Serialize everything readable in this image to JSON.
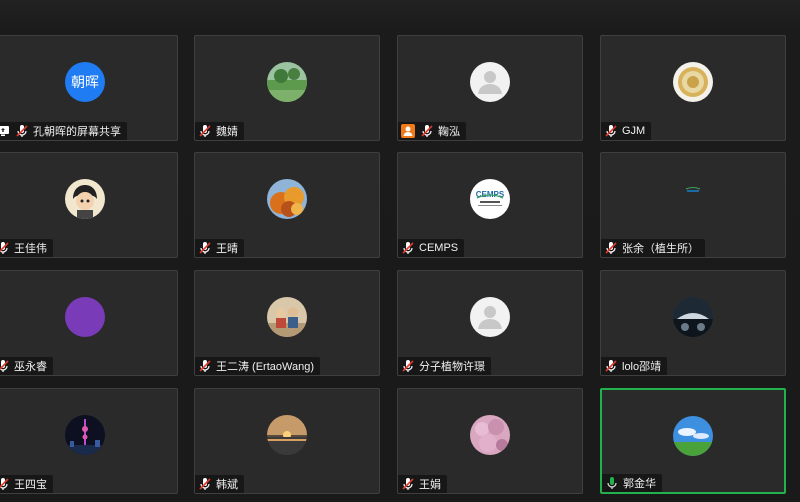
{
  "participants": [
    {
      "name": "孔朝晖的屏幕共享",
      "avatar_text": "朝晖",
      "avatar_kind": "text",
      "avatar_color": "#1f7cf2",
      "mic": "muted",
      "badge": "screen-share-icon"
    },
    {
      "name": "魏婧",
      "avatar_kind": "photo-landscape-green",
      "mic": "muted"
    },
    {
      "name": "鞠泓",
      "avatar_kind": "default-user",
      "mic": "muted",
      "badge": "host-avatar-icon"
    },
    {
      "name": "GJM",
      "avatar_kind": "photo-coin",
      "mic": "muted"
    },
    {
      "name": "王佳伟",
      "avatar_kind": "photo-cartoon-boy",
      "mic": "muted"
    },
    {
      "name": "王晴",
      "avatar_kind": "photo-autumn-leaves",
      "mic": "muted"
    },
    {
      "name": "CEMPS",
      "avatar_kind": "logo-cemps",
      "avatar_text": "CEMPS",
      "mic": "muted"
    },
    {
      "name": "张余（植生所）",
      "avatar_kind": "logo-small-cemps",
      "mic": "muted"
    },
    {
      "name": "巫永睿",
      "avatar_kind": "solid",
      "avatar_color": "#7a3bb8",
      "mic": "muted"
    },
    {
      "name": "王二涛 (ErtaoWang)",
      "avatar_kind": "photo-people",
      "mic": "muted"
    },
    {
      "name": "分子植物许璟",
      "avatar_kind": "default-user",
      "mic": "muted"
    },
    {
      "name": "lolo邵靖",
      "avatar_kind": "photo-car",
      "mic": "muted"
    },
    {
      "name": "王四宝",
      "avatar_kind": "photo-tower-night",
      "mic": "muted"
    },
    {
      "name": "韩斌",
      "avatar_kind": "photo-sunset",
      "mic": "muted"
    },
    {
      "name": "王娟",
      "avatar_kind": "photo-flowers",
      "mic": "muted"
    },
    {
      "name": "郭金华",
      "avatar_kind": "photo-sky-grass",
      "mic": "active",
      "active": true
    }
  ],
  "colors": {
    "tile_bg": "#2a2a2a",
    "active_border": "#22b14c",
    "muted_mic": "#e0392f",
    "active_mic": "#22b14c"
  },
  "edge_mark": "×"
}
